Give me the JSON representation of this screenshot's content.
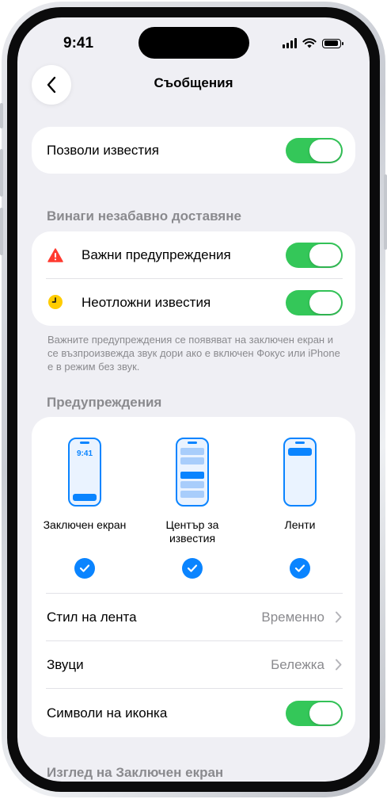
{
  "status_bar": {
    "time": "9:41"
  },
  "nav": {
    "title": "Съобщения",
    "back_icon": "chevron-left-icon"
  },
  "allow_notifications": {
    "label": "Позволи известия",
    "enabled": true
  },
  "immediate_delivery": {
    "section_title": "Винаги незабавно доставяне",
    "items": [
      {
        "label": "Важни предупреждения",
        "icon": "warning-triangle-icon",
        "icon_color": "#ff3b30",
        "enabled": true
      },
      {
        "label": "Неотложни известия",
        "icon": "clock-icon",
        "icon_color": "#ffcc00",
        "enabled": true
      }
    ],
    "footnote": "Важните предупреждения се появяват на заключен екран и се възпроизвежда звук дори ако е включен Фокус или iPhone е в режим без звук."
  },
  "alerts": {
    "section_title": "Предупреждения",
    "styles": [
      {
        "label": "Заключен екран",
        "preview_time": "9:41",
        "checked": true
      },
      {
        "label": "Център за известия",
        "checked": true
      },
      {
        "label": "Ленти",
        "checked": true
      }
    ],
    "banner_style": {
      "label": "Стил на лента",
      "value": "Временно"
    },
    "sounds": {
      "label": "Звуци",
      "value": "Бележка"
    },
    "badges": {
      "label": "Символи на иконка",
      "enabled": true
    }
  },
  "lock_screen_section": {
    "title": "Изглед на Заключен екран"
  },
  "colors": {
    "accent": "#0a84ff",
    "toggle_on": "#34c759",
    "background": "#efeff4"
  }
}
